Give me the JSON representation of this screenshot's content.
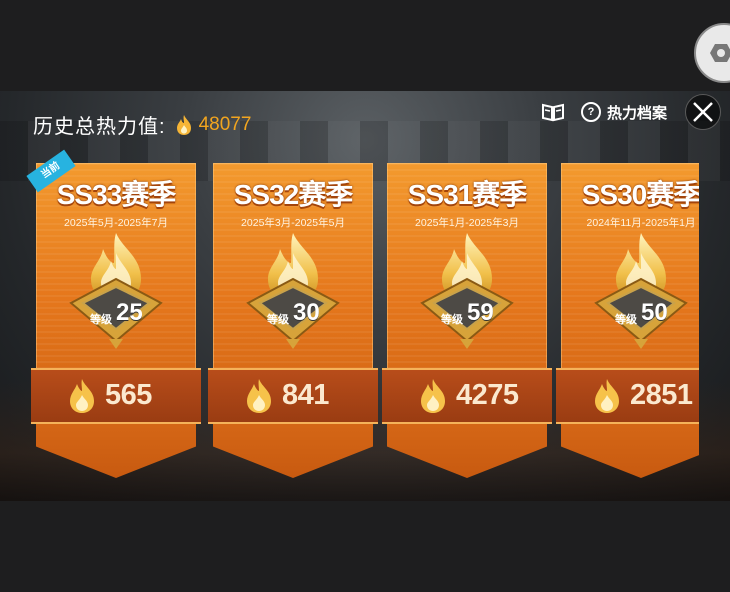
{
  "header": {
    "heat_label": "历史总热力值:",
    "heat_total": "48077",
    "archive_label": "热力档案"
  },
  "icons": {
    "settings": "hexagon-gear-icon",
    "book": "book-icon",
    "help": "help-icon",
    "close": "close-icon",
    "flame": "flame-icon"
  },
  "cards": [
    {
      "season": "SS33赛季",
      "dates": "2025年5月-2025年7月",
      "level_word": "等级",
      "level": "25",
      "heat": "565",
      "current_tag": "当前"
    },
    {
      "season": "SS32赛季",
      "dates": "2025年3月-2025年5月",
      "level_word": "等级",
      "level": "30",
      "heat": "841"
    },
    {
      "season": "SS31赛季",
      "dates": "2025年1月-2025年3月",
      "level_word": "等级",
      "level": "59",
      "heat": "4275"
    },
    {
      "season": "SS30赛季",
      "dates": "2024年11月-2025年1月",
      "level_word": "等级",
      "level": "50",
      "heat": "2851"
    }
  ],
  "colors": {
    "accent_gold": "#f2a51f",
    "card_orange": "#e5771c",
    "current_tag": "#27b3e0"
  }
}
